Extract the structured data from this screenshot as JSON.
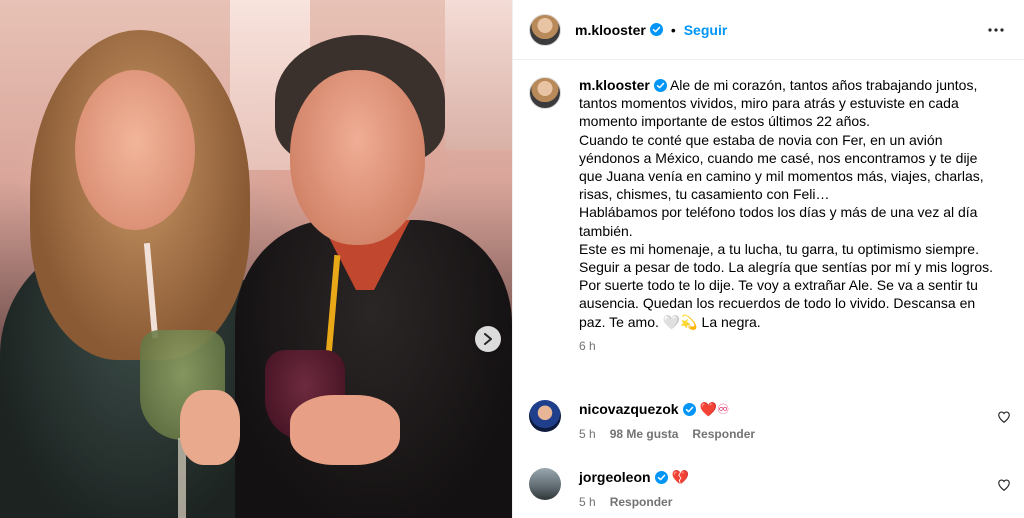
{
  "post": {
    "author": "m.klooster",
    "follow_label": "Seguir",
    "dot": "•",
    "caption": "Ale de mi corazón, tantos años trabajando juntos, tantos momentos vividos, miro para atrás y estuviste en cada momento importante de estos últimos 22 años.",
    "caption_lines": [
      "Cuando te conté que estaba de novia con Fer, en un avión yéndonos a México, cuando me casé, nos encontramos y te dije que Juana venía en camino y mil momentos más, viajes, charlas, risas, chismes, tu casamiento con Feli…",
      "Hablábamos por teléfono todos los días y más de una vez al día también.",
      "Este es mi homenaje, a tu lucha, tu garra, tu optimismo siempre. Seguir a pesar de todo. La alegría que sentías por mí y mis logros.",
      "Por suerte todo te lo dije. Te voy a extrañar Ale. Se va a sentir tu ausencia. Quedan los recuerdos de todo lo vivido. Descansa en paz. Te amo. 🤍💫 La negra."
    ],
    "time": "6 h"
  },
  "comments": [
    {
      "user": "nicovazquezok",
      "text": "❤️♾",
      "time": "5 h",
      "likes": "98 Me gusta",
      "reply": "Responder"
    },
    {
      "user": "jorgeoleon",
      "text": "💔",
      "time": "5 h",
      "reply": "Responder"
    }
  ],
  "icons": {
    "verified": "verified-badge-icon",
    "more": "more-options-icon",
    "next": "chevron-right-icon",
    "like": "heart-outline-icon"
  },
  "colors": {
    "accent": "#0095f6",
    "verified": "#0095f6",
    "secondary_text": "#737373"
  }
}
